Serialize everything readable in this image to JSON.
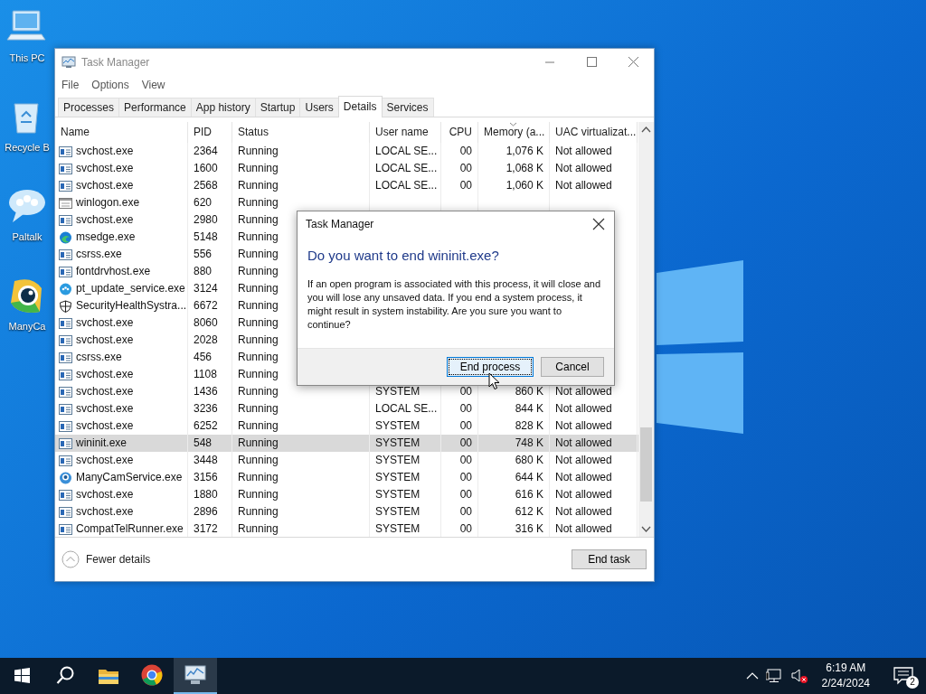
{
  "desktop_icons": [
    {
      "label": "This PC",
      "kind": "computer"
    },
    {
      "label": "Recycle B",
      "kind": "recycle"
    },
    {
      "label": "Paltalk",
      "kind": "chat"
    },
    {
      "label": "ManyCa",
      "kind": "camera"
    }
  ],
  "window": {
    "title": "Task Manager",
    "menu": [
      "File",
      "Options",
      "View"
    ],
    "tabs": [
      {
        "label": "Processes",
        "selected": false
      },
      {
        "label": "Performance",
        "selected": false
      },
      {
        "label": "App history",
        "selected": false
      },
      {
        "label": "Startup",
        "selected": false
      },
      {
        "label": "Users",
        "selected": false
      },
      {
        "label": "Details",
        "selected": true
      },
      {
        "label": "Services",
        "selected": false
      }
    ],
    "table": {
      "columns": [
        {
          "label": "Name",
          "sorted": false
        },
        {
          "label": "PID",
          "sorted": false
        },
        {
          "label": "Status",
          "sorted": false
        },
        {
          "label": "User name",
          "sorted": false
        },
        {
          "label": "CPU",
          "sorted": false
        },
        {
          "label": "Memory (a...",
          "sorted": true
        },
        {
          "label": "UAC virtualizat...",
          "sorted": false
        }
      ],
      "rows": [
        {
          "kind": "app",
          "name": "svchost.exe",
          "pid": "2364",
          "status": "Running",
          "user": "LOCAL SE...",
          "cpu": "00",
          "memory": "1,076 K",
          "uac": "Not allowed",
          "selected": false
        },
        {
          "kind": "app",
          "name": "svchost.exe",
          "pid": "1600",
          "status": "Running",
          "user": "LOCAL SE...",
          "cpu": "00",
          "memory": "1,068 K",
          "uac": "Not allowed",
          "selected": false
        },
        {
          "kind": "app",
          "name": "svchost.exe",
          "pid": "2568",
          "status": "Running",
          "user": "LOCAL SE...",
          "cpu": "00",
          "memory": "1,060 K",
          "uac": "Not allowed",
          "selected": false
        },
        {
          "kind": "window",
          "name": "winlogon.exe",
          "pid": "620",
          "status": "Running",
          "selected": false
        },
        {
          "kind": "app",
          "name": "svchost.exe",
          "pid": "2980",
          "status": "Running",
          "selected": false
        },
        {
          "kind": "edge",
          "name": "msedge.exe",
          "pid": "5148",
          "status": "Running",
          "selected": false
        },
        {
          "kind": "app",
          "name": "csrss.exe",
          "pid": "556",
          "status": "Running",
          "selected": false
        },
        {
          "kind": "app",
          "name": "fontdrvhost.exe",
          "pid": "880",
          "status": "Running",
          "selected": false
        },
        {
          "kind": "chat",
          "name": "pt_update_service.exe",
          "pid": "3124",
          "status": "Running",
          "selected": false
        },
        {
          "kind": "shield",
          "name": "SecurityHealthSystra...",
          "pid": "6672",
          "status": "Running",
          "selected": false
        },
        {
          "kind": "app",
          "name": "svchost.exe",
          "pid": "8060",
          "status": "Running",
          "selected": false
        },
        {
          "kind": "app",
          "name": "svchost.exe",
          "pid": "2028",
          "status": "Running",
          "selected": false
        },
        {
          "kind": "app",
          "name": "csrss.exe",
          "pid": "456",
          "status": "Running",
          "selected": false
        },
        {
          "kind": "app",
          "name": "svchost.exe",
          "pid": "1108",
          "status": "Running",
          "selected": false
        },
        {
          "kind": "app",
          "name": "svchost.exe",
          "pid": "1436",
          "status": "Running",
          "user": "SYSTEM",
          "cpu": "00",
          "memory": "860 K",
          "uac": "Not allowed",
          "selected": false
        },
        {
          "kind": "app",
          "name": "svchost.exe",
          "pid": "3236",
          "status": "Running",
          "user": "LOCAL SE...",
          "cpu": "00",
          "memory": "844 K",
          "uac": "Not allowed",
          "selected": false
        },
        {
          "kind": "app",
          "name": "svchost.exe",
          "pid": "6252",
          "status": "Running",
          "user": "SYSTEM",
          "cpu": "00",
          "memory": "828 K",
          "uac": "Not allowed",
          "selected": false
        },
        {
          "kind": "app",
          "name": "wininit.exe",
          "pid": "548",
          "status": "Running",
          "user": "SYSTEM",
          "cpu": "00",
          "memory": "748 K",
          "uac": "Not allowed",
          "selected": true
        },
        {
          "kind": "app",
          "name": "svchost.exe",
          "pid": "3448",
          "status": "Running",
          "user": "SYSTEM",
          "cpu": "00",
          "memory": "680 K",
          "uac": "Not allowed",
          "selected": false
        },
        {
          "kind": "camera",
          "name": "ManyCamService.exe",
          "pid": "3156",
          "status": "Running",
          "user": "SYSTEM",
          "cpu": "00",
          "memory": "644 K",
          "uac": "Not allowed",
          "selected": false
        },
        {
          "kind": "app",
          "name": "svchost.exe",
          "pid": "1880",
          "status": "Running",
          "user": "SYSTEM",
          "cpu": "00",
          "memory": "616 K",
          "uac": "Not allowed",
          "selected": false
        },
        {
          "kind": "app",
          "name": "svchost.exe",
          "pid": "2896",
          "status": "Running",
          "user": "SYSTEM",
          "cpu": "00",
          "memory": "612 K",
          "uac": "Not allowed",
          "selected": false
        },
        {
          "kind": "app",
          "name": "CompatTelRunner.exe",
          "pid": "3172",
          "status": "Running",
          "user": "SYSTEM",
          "cpu": "00",
          "memory": "316 K",
          "uac": "Not allowed",
          "selected": false
        }
      ]
    },
    "fewer_details": "Fewer details",
    "end_task": "End task"
  },
  "dialog": {
    "title": "Task Manager",
    "heading": "Do you want to end wininit.exe?",
    "message": "If an open program is associated with this process, it will close and you will lose any unsaved data. If you end a system process, it might result in system instability. Are you sure you want to continue?",
    "buttons": [
      {
        "label": "End process",
        "default": true
      },
      {
        "label": "Cancel",
        "default": false
      }
    ]
  },
  "taskbar": {
    "apps": [
      {
        "kind": "start",
        "active": false
      },
      {
        "kind": "search",
        "active": false
      },
      {
        "kind": "folder",
        "active": false
      },
      {
        "kind": "browser",
        "active": false
      },
      {
        "kind": "taskmgr",
        "active": true
      }
    ],
    "time": "6:19 AM",
    "date": "2/24/2024",
    "notifications": "2"
  }
}
